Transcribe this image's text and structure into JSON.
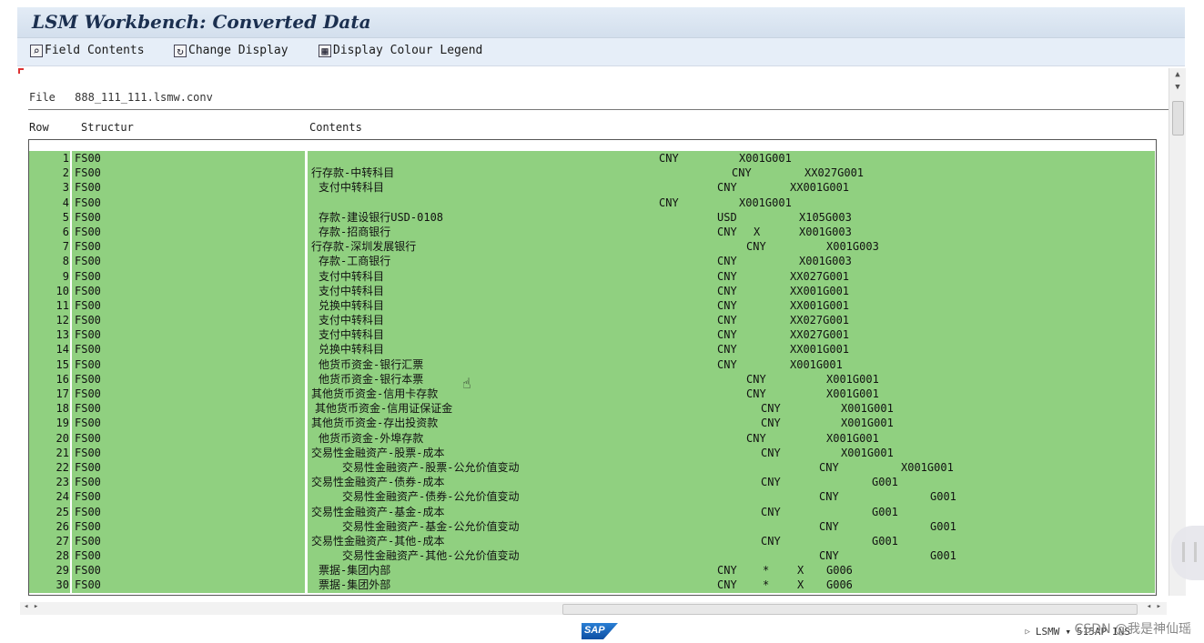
{
  "window": {
    "title": "LSM Workbench: Converted Data"
  },
  "toolbar": {
    "items": [
      {
        "label": "Field Contents",
        "icon": "magnifier-icon"
      },
      {
        "label": "Change Display",
        "icon": "change-display-icon"
      },
      {
        "label": "Display Colour Legend",
        "icon": "legend-icon"
      }
    ]
  },
  "file": {
    "label": "File",
    "name": "888_111_111.lsmw.conv"
  },
  "columns": {
    "row": "Row",
    "structure": "Structur",
    "contents": "Contents"
  },
  "rows": [
    {
      "num": "1",
      "struct": "FS00",
      "desc": "",
      "cur": "CNY",
      "code": "X001G001",
      "xflag": "",
      "star": ""
    },
    {
      "num": "2",
      "struct": "FS00",
      "desc": "行存款-中转科目",
      "cur": "CNY",
      "code": "XX027G001",
      "xflag": "",
      "star": ""
    },
    {
      "num": "3",
      "struct": "FS00",
      "desc": "支付中转科目",
      "cur": "CNY",
      "code": "XX001G001",
      "xflag": "",
      "star": ""
    },
    {
      "num": "4",
      "struct": "FS00",
      "desc": "",
      "cur": "CNY",
      "code": "X001G001",
      "xflag": "",
      "star": ""
    },
    {
      "num": "5",
      "struct": "FS00",
      "desc": "存款-建设银行USD-0108",
      "cur": "USD",
      "code": "X105G003",
      "xflag": "",
      "star": ""
    },
    {
      "num": "6",
      "struct": "FS00",
      "desc": "存款-招商银行",
      "cur": "CNY",
      "code": "X001G003",
      "xflag": "X",
      "star": ""
    },
    {
      "num": "7",
      "struct": "FS00",
      "desc": "行存款-深圳发展银行",
      "cur": "CNY",
      "code": "X001G003",
      "xflag": "",
      "star": ""
    },
    {
      "num": "8",
      "struct": "FS00",
      "desc": "存款-工商银行",
      "cur": "CNY",
      "code": "X001G003",
      "xflag": "",
      "star": ""
    },
    {
      "num": "9",
      "struct": "FS00",
      "desc": "支付中转科目",
      "cur": "CNY",
      "code": "XX027G001",
      "xflag": "",
      "star": ""
    },
    {
      "num": "10",
      "struct": "FS00",
      "desc": "支付中转科目",
      "cur": "CNY",
      "code": "XX001G001",
      "xflag": "",
      "star": ""
    },
    {
      "num": "11",
      "struct": "FS00",
      "desc": "兑换中转科目",
      "cur": "CNY",
      "code": "XX001G001",
      "xflag": "",
      "star": ""
    },
    {
      "num": "12",
      "struct": "FS00",
      "desc": "支付中转科目",
      "cur": "CNY",
      "code": "XX027G001",
      "xflag": "",
      "star": ""
    },
    {
      "num": "13",
      "struct": "FS00",
      "desc": "支付中转科目",
      "cur": "CNY",
      "code": "XX027G001",
      "xflag": "",
      "star": ""
    },
    {
      "num": "14",
      "struct": "FS00",
      "desc": "兑换中转科目",
      "cur": "CNY",
      "code": "XX001G001",
      "xflag": "",
      "star": ""
    },
    {
      "num": "15",
      "struct": "FS00",
      "desc": "他货币资金-银行汇票",
      "cur": "CNY",
      "code": "X001G001",
      "xflag": "",
      "star": ""
    },
    {
      "num": "16",
      "struct": "FS00",
      "desc": "他货币资金-银行本票",
      "cur": "CNY",
      "code": "X001G001",
      "xflag": "",
      "star": ""
    },
    {
      "num": "17",
      "struct": "FS00",
      "desc": "其他货币资金-信用卡存款",
      "cur": "CNY",
      "code": "X001G001",
      "xflag": "",
      "star": ""
    },
    {
      "num": "18",
      "struct": "FS00",
      "desc": "其他货币资金-信用证保证金",
      "cur": "CNY",
      "code": "X001G001",
      "xflag": "",
      "star": ""
    },
    {
      "num": "19",
      "struct": "FS00",
      "desc": "其他货币资金-存出投资款",
      "cur": "CNY",
      "code": "X001G001",
      "xflag": "",
      "star": ""
    },
    {
      "num": "20",
      "struct": "FS00",
      "desc": "他货币资金-外埠存款",
      "cur": "CNY",
      "code": "X001G001",
      "xflag": "",
      "star": ""
    },
    {
      "num": "21",
      "struct": "FS00",
      "desc": "交易性金融资产-股票-成本",
      "cur": "CNY",
      "code": "X001G001",
      "xflag": "",
      "star": ""
    },
    {
      "num": "22",
      "struct": "FS00",
      "desc": "交易性金融资产-股票-公允价值变动",
      "cur": "CNY",
      "code": "X001G001",
      "xflag": "",
      "star": ""
    },
    {
      "num": "23",
      "struct": "FS00",
      "desc": "交易性金融资产-债券-成本",
      "cur": "CNY",
      "code": "G001",
      "xflag": "",
      "star": ""
    },
    {
      "num": "24",
      "struct": "FS00",
      "desc": "交易性金融资产-债券-公允价值变动",
      "cur": "CNY",
      "code": "G001",
      "xflag": "",
      "star": ""
    },
    {
      "num": "25",
      "struct": "FS00",
      "desc": "交易性金融资产-基金-成本",
      "cur": "CNY",
      "code": "G001",
      "xflag": "",
      "star": ""
    },
    {
      "num": "26",
      "struct": "FS00",
      "desc": "交易性金融资产-基金-公允价值变动",
      "cur": "CNY",
      "code": "G001",
      "xflag": "",
      "star": ""
    },
    {
      "num": "27",
      "struct": "FS00",
      "desc": "交易性金融资产-其他-成本",
      "cur": "CNY",
      "code": "G001",
      "xflag": "",
      "star": ""
    },
    {
      "num": "28",
      "struct": "FS00",
      "desc": "交易性金融资产-其他-公允价值变动",
      "cur": "CNY",
      "code": "G001",
      "xflag": "",
      "star": ""
    },
    {
      "num": "29",
      "struct": "FS00",
      "desc": "票据-集团内部",
      "cur": "CNY",
      "code": "G006",
      "xflag": "X",
      "star": "*"
    },
    {
      "num": "30",
      "struct": "FS00",
      "desc": "票据-集团外部",
      "cur": "CNY",
      "code": "G006",
      "xflag": "X",
      "star": "*"
    }
  ],
  "status": {
    "sap_logo": "SAP",
    "system": "LSMW",
    "server": "515AP",
    "mode": "INS"
  },
  "watermark": "CSDN @我是神仙瑶",
  "colors": {
    "row_green": "#90d080",
    "toolbar_bg": "#e6eef8",
    "title_color": "#1b2f4f"
  }
}
